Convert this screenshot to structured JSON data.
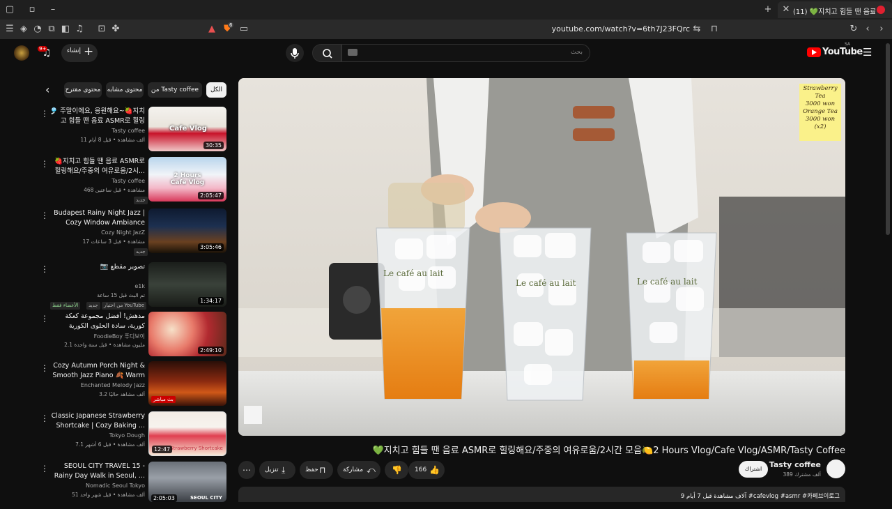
{
  "browser": {
    "url": "youtube.com/watch?v=6th7J23FQrc",
    "tab_title": "(11) 💚지치고 힘들 땐 음료 ASM",
    "shield_badge": "6"
  },
  "header": {
    "create_label": "إنشاء",
    "notif_count": "9+",
    "search_placeholder": "بحث",
    "logo_text": "YouTube",
    "logo_region": "SA"
  },
  "chips": [
    {
      "label": "الكل"
    },
    {
      "label": "من Tasty coffee"
    },
    {
      "label": "محتوى مشابه"
    },
    {
      "label": "محتوى مقترح"
    }
  ],
  "recommendations": [
    {
      "title": "🎐 주말이에요, 응원해요~🍓지치고 힘들 땐 음료 ASMR로 힐링",
      "channel": "Tasty coffee",
      "meta": "11 ألف مشاهدة • قبل 8 أيام",
      "duration": "30:35",
      "badge": ""
    },
    {
      "title": "🍓지치고 힘들 땐 음료 ASMR로 힐링해요/주중의 여유로움/2시...",
      "channel": "Tasty coffee",
      "meta": "468 مشاهدة • قبل ساعتين",
      "duration": "2:05:47",
      "badge": "جديد"
    },
    {
      "title": "Budapest Rainy Night Jazz | Cozy Window Ambiance With ...",
      "channel": "Cozy Night JazZ",
      "meta": "17 مشاهدة • قبل 3 ساعات",
      "duration": "3:05:46",
      "badge": "جديد"
    },
    {
      "title": "📷 تصوير مقطع",
      "channel": "e1k",
      "meta": "تم البث قبل 15 ساعة",
      "duration": "1:34:17",
      "badge": "جديد"
    },
    {
      "title": "مدهش! أفضل مجموعة كعكة كورية، سادة الحلوى الكورية",
      "channel": "FoodieBoy 푸디보이",
      "meta": "2.1 مليون مشاهدة • قبل سنة واحدة",
      "duration": "2:49:10",
      "badge": ""
    },
    {
      "title": "Cozy Autumn Porch Night & Smooth Jazz Piano 🍂 Warm ...",
      "channel": "Enchanted Melody Jazz",
      "meta": "3.2 ألف مشاهد حاليًا",
      "duration": "",
      "badge": ""
    },
    {
      "title": "Classic Japanese Strawberry Shortcake | Cozy Baking ...",
      "channel": "Tokyo Dough",
      "meta": "7.1 ألف مشاهدة • قبل 6 أشهر",
      "duration": "12:47",
      "badge": ""
    },
    {
      "title": "SEOUL CITY TRAVEL 15 - Rainy Day Walk in Seoul, ...",
      "channel": "Nomadic Seoul Tokyo",
      "meta": "51 ألف مشاهدة • قبل شهر واحد",
      "duration": "2:05:03",
      "badge": ""
    }
  ],
  "rec_extras": {
    "from_youtube": "من اختيار YouTube",
    "members_only": "الأعضاء فقط",
    "live_label": "بث مباشر",
    "thumb_text_1": "Cafe Vlog",
    "thumb_text_2": "2 Hours Cafe Vlog",
    "thumb_text_7": "Strawberry Shortcake",
    "thumb_text_8": "SEOUL CITY"
  },
  "player": {
    "menu_board": [
      "Strawberry",
      "Tea",
      "3000 won",
      "Orange Tea",
      "3000 won",
      "(x2)"
    ],
    "glass_text": "Le café au lait"
  },
  "video": {
    "title": "💚지치고 힘들 땐 음료 ASMR로 힐링해요/주중의 여유로움/2시간 모음🍋2 Hours Vlog/Cafe Vlog/ASMR/Tasty Coffee",
    "channel": "Tasty coffee",
    "subscribers": "389 ألف مشترك",
    "subscribe_label": "اشتراك",
    "likes": "166",
    "share_label": "مشاركة",
    "save_label": "حفظ",
    "download_label": "تنزيل",
    "description": "9 آلاف مشاهدة قبل 7 أيام  #cafevlog #asmr #카페브이로그"
  },
  "colors": {
    "bg": "#0f0f0f",
    "chip": "#272727",
    "brand_red": "#ff0000",
    "active_chip": "#f1f1f1"
  }
}
